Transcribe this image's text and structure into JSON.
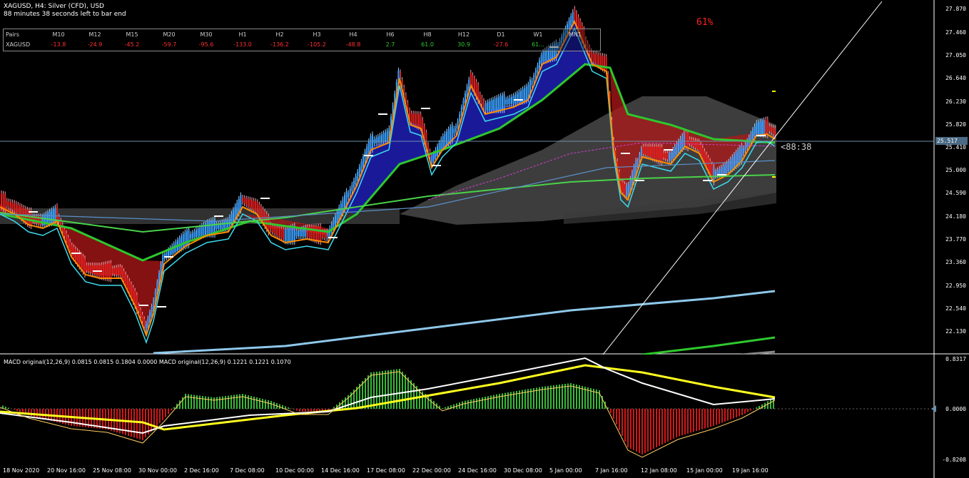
{
  "header": {
    "title": "XAGUSD, H4:  Silver (CFD), USD",
    "timer_text": "88 minutes 38 seconds left to bar end"
  },
  "pairs_table": {
    "columns": [
      "Pairs",
      "M10",
      "M12",
      "M15",
      "M20",
      "M30",
      "H1",
      "H2",
      "H3",
      "H4",
      "H6",
      "H8",
      "H12",
      "D1",
      "W1",
      "MN1"
    ],
    "row": {
      "pair": "XAGUSD",
      "values": [
        "-13.8",
        "-24.9",
        "-45.2",
        "-59.7",
        "-95.6",
        "-133.0",
        "-136.2",
        "-105.2",
        "-48.8",
        "2.7",
        "61.0",
        "30.9",
        "-27.6",
        "61...",
        ""
      ]
    },
    "value_colors": [
      "red",
      "red",
      "red",
      "red",
      "red",
      "red",
      "red",
      "red",
      "red",
      "green",
      "green",
      "green",
      "red",
      "green",
      "green"
    ]
  },
  "overlay": {
    "percent_label": "61%",
    "countdown": "<88:38",
    "current_price": "25.517"
  },
  "price_axis": [
    "27.870",
    "27.460",
    "27.050",
    "26.640",
    "26.230",
    "25.820",
    "25.410",
    "25.000",
    "24.590",
    "24.180",
    "23.770",
    "23.360",
    "22.950",
    "22.540",
    "22.130"
  ],
  "macd": {
    "label": "MACD original(12,26,9) 0.0815 0.0815 0.1804 0.0000 MACD original(12,26,9) 0.1221 0.1221 0.1070",
    "axis": [
      "0.8317",
      "0.0000",
      "-0.8208"
    ]
  },
  "time_axis": [
    "18 Nov 2020",
    "20 Nov 16:00",
    "25 Nov 08:00",
    "30 Nov 00:00",
    "2 Dec 16:00",
    "7 Dec 08:00",
    "10 Dec 00:00",
    "14 Dec 16:00",
    "17 Dec 08:00",
    "22 Dec 00:00",
    "24 Dec 16:00",
    "30 Dec 08:00",
    "5 Jan 00:00",
    "7 Jan 16:00",
    "12 Jan 08:00",
    "15 Jan 00:00",
    "19 Jan 16:00"
  ],
  "colors": {
    "bull": "#3aa0ff",
    "bear": "#e02020",
    "cloud_blue": "#1e1eb4",
    "cloud_red": "#b01818",
    "cloud_gray": "#7a7a7a",
    "ma_light_blue": "#8ec8ea",
    "ma_green": "#2ec82e",
    "ma_cyan": "#3cdcf0",
    "ma_orange": "#ff8c00",
    "macd_yellow": "#ffff1e",
    "macd_hist_green": "#38b838",
    "macd_hist_red": "#d01818"
  }
}
